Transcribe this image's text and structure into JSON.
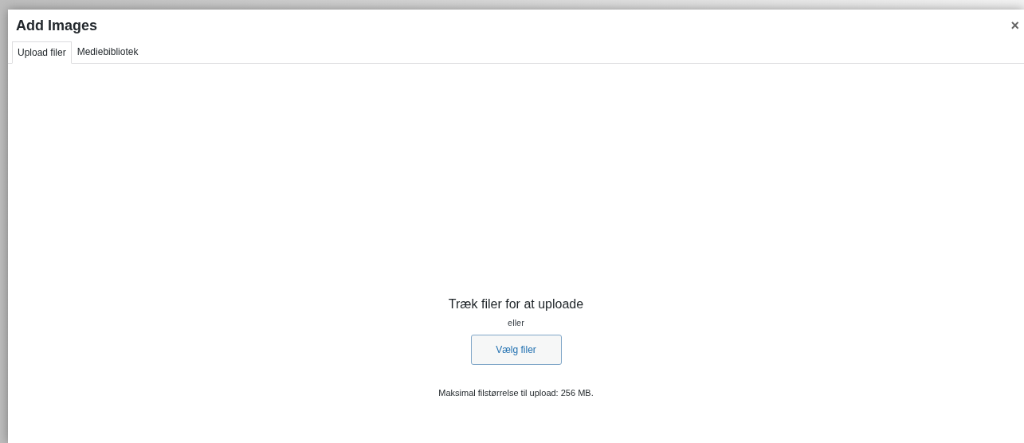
{
  "dialog": {
    "title": "Add Images",
    "close": "×"
  },
  "tabs": [
    {
      "label": "Upload filer",
      "selected": true
    },
    {
      "label": "Mediebibliotek",
      "selected": false
    }
  ],
  "upload": {
    "heading": "Træk filer for at uploade",
    "or": "eller",
    "button": "Vælg filer",
    "note": "Maksimal filstørrelse til upload: 256 MB."
  }
}
